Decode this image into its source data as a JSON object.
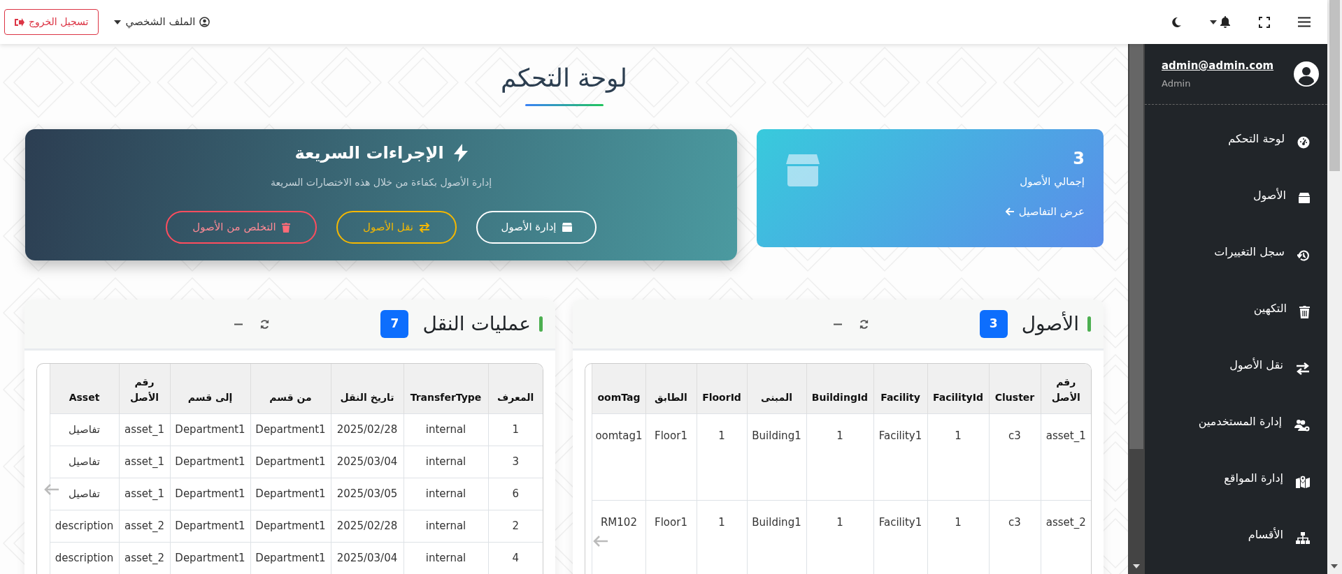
{
  "topbar": {
    "logout_button": "تسجيل الخروج",
    "profile_menu": "الملف الشخصي"
  },
  "page_title": "لوحة التحكم",
  "quick_actions": {
    "title": "الإجراءات السريعة",
    "subtitle": "إدارة الأصول بكفاءة من خلال هذه الاختصارات السريعة",
    "buttons": [
      {
        "label": "إدارة الأصول",
        "kind": "manage"
      },
      {
        "label": "نقل الأصول",
        "kind": "transfer"
      },
      {
        "label": "التخلص من الأصول",
        "kind": "dispose"
      }
    ]
  },
  "stat_card": {
    "value": "3",
    "label": "إجمالي الأصول",
    "link": "عرض التفاصيل"
  },
  "panels": [
    {
      "title": "الأصول",
      "count": "3",
      "table": {
        "columns": [
          "رقم الأصل",
          "Cluster",
          "FacilityId",
          "Facility",
          "BuildingId",
          "المبنى",
          "FloorId",
          "الطابق",
          "oomTag"
        ],
        "rows": [
          [
            "asset_1",
            "c3",
            "1",
            "Facility1",
            "1",
            "Building1",
            "1",
            "Floor1",
            "oomtag1"
          ],
          [
            "asset_2",
            "c3",
            "1",
            "Facility1",
            "1",
            "Building1",
            "1",
            "Floor1",
            "RM102"
          ]
        ]
      }
    },
    {
      "title": "عمليات النقل",
      "count": "7",
      "table": {
        "columns": [
          "المعرف",
          "TransferType",
          "تاريخ النقل",
          "من قسم",
          "إلى قسم",
          "رقم الأصل",
          "Asset"
        ],
        "rows": [
          [
            "1",
            "internal",
            "2025/02/28",
            "Department1",
            "Department1",
            "asset_1",
            "تفاصيل"
          ],
          [
            "3",
            "internal",
            "2025/03/04",
            "Department1",
            "Department1",
            "asset_1",
            "تفاصيل"
          ],
          [
            "6",
            "internal",
            "2025/03/05",
            "Department1",
            "Department1",
            "asset_1",
            "تفاصيل"
          ],
          [
            "2",
            "internal",
            "2025/02/28",
            "Department1",
            "Department1",
            "asset_2",
            "description"
          ],
          [
            "4",
            "internal",
            "2025/03/04",
            "Department1",
            "Department1",
            "asset_2",
            "description"
          ]
        ]
      }
    }
  ],
  "sidebar": {
    "user": {
      "email": "admin@admin.com",
      "role": "Admin"
    },
    "items": [
      {
        "label": "لوحة التحكم",
        "kind": "dashboard"
      },
      {
        "label": "الأصول",
        "kind": "assets"
      },
      {
        "label": "سجل التغييرات",
        "kind": "history"
      },
      {
        "label": "التكهين",
        "kind": "trash"
      },
      {
        "label": "نقل الأصول",
        "kind": "transfer"
      },
      {
        "label": "إدارة المستخدمين",
        "kind": "users"
      },
      {
        "label": "إدارة المواقع",
        "kind": "map"
      },
      {
        "label": "الأقسام",
        "kind": "sitemap"
      }
    ]
  }
}
